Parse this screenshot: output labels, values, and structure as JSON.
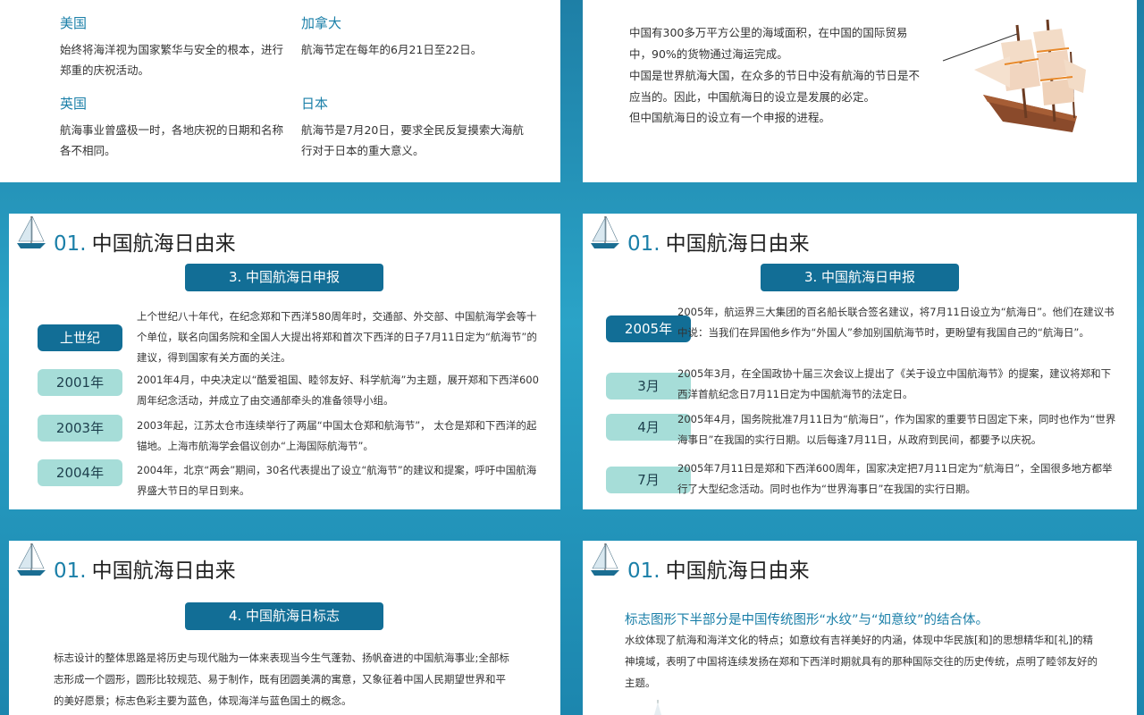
{
  "slide1": {
    "items": [
      {
        "country": "美国",
        "text": "始终将海洋视为国家繁华与安全的根本，进行郑重的庆祝活动。"
      },
      {
        "country": "加拿大",
        "text": "航海节定在每年的6月21日至22日。"
      },
      {
        "country": "英国",
        "text": "航海事业曾盛极一时，各地庆祝的日期和名称各不相同。"
      },
      {
        "country": "日本",
        "text": "航海节是7月20日，要求全民反复摸索大海航行对于日本的重大意义。"
      }
    ]
  },
  "slide2": {
    "lines": [
      "中国有300多万平方公里的海域面积，在中国的国际贸易中，90%的货物通过海运完成。",
      "中国是世界航海大国，在众多的节日中没有航海的节日是不应当的。因此，中国航海日的设立是发展的必定。",
      "但中国航海日的设立有一个申报的进程。"
    ]
  },
  "heading": {
    "num": "01.",
    "title": "中国航海日由来"
  },
  "slide3": {
    "pill": "3.  中国航海日申报",
    "rows": [
      {
        "tag": "上世纪",
        "text": "上个世纪八十年代，在纪念郑和下西洋580周年时，交通部、外交部、中国航海学会等十个单位，联名向国务院和全国人大提出将郑和首次下西洋的日子7月11日定为“航海节”的建议，得到国家有关方面的关注。"
      },
      {
        "tag": "2001年",
        "text": "2001年4月，中央决定以“酷爱祖国、睦邻友好、科学航海”为主题，展开郑和下西洋600周年纪念活动，并成立了由交通部牵头的准备领导小组。"
      },
      {
        "tag": "2003年",
        "text": "2003年起，江苏太仓市连续举行了两届“中国太仓郑和航海节”， 太仓是郑和下西洋的起锚地。上海市航海学会倡议创办“上海国际航海节”。"
      },
      {
        "tag": "2004年",
        "text": "2004年，北京“两会”期间，30名代表提出了设立“航海节”的建议和提案，呼吁中国航海界盛大节日的早日到来。"
      }
    ]
  },
  "slide4": {
    "pill": "3.  中国航海日申报",
    "rows": [
      {
        "tag": "2005年",
        "text": "2005年，航运界三大集团的百名船长联合签名建议，将7月11日设立为“航海日”。他们在建议书中说：当我们在异国他乡作为“外国人”参加别国航海节时，更盼望有我国自己的“航海日”。"
      },
      {
        "tag": "3月",
        "text": "2005年3月，在全国政协十届三次会议上提出了《关于设立中国航海节》的提案，建议将郑和下西洋首航纪念日7月11日定为中国航海节的法定日。"
      },
      {
        "tag": "4月",
        "text": "2005年4月，国务院批准7月11日为“航海日”，作为国家的重要节日固定下来，同时也作为“世界海事日”在我国的实行日期。以后每逢7月11日，从政府到民间，都要予以庆祝。"
      },
      {
        "tag": "7月",
        "text": "2005年7月11日是郑和下西洋600周年，国家决定把7月11日定为“航海日”，全国很多地方都举行了大型纪念活动。同时也作为“世界海事日”在我国的实行日期。"
      }
    ]
  },
  "slide5": {
    "pill": "4.  中国航海日标志",
    "text": "标志设计的整体思路是将历史与现代融为一体来表现当今生气蓬勃、扬帆奋进的中国航海事业;全部标志形成一个圆形，圆形比较规范、易于制作，既有团圆美满的寓意，又象征着中国人民期望世界和平的美好愿景；标志色彩主要为蓝色，体现海洋与蓝色国土的概念。"
  },
  "slide6": {
    "subtitle": "标志图形下半部分是中国传统图形“水纹”与“如意纹”的结合体。",
    "text": "水纹体现了航海和海洋文化的特点；如意纹有吉祥美好的内涵，体现中华民族[和]的思想精华和[礼]的精神境域，表明了中国将连续发扬在郑和下西洋时期就具有的那种国际交往的历史传统，点明了睦邻友好的主题。"
  },
  "colors": {
    "accent": "#126e96",
    "light_tag": "#a6ddd8",
    "title_blue": "#1a7fa8"
  }
}
